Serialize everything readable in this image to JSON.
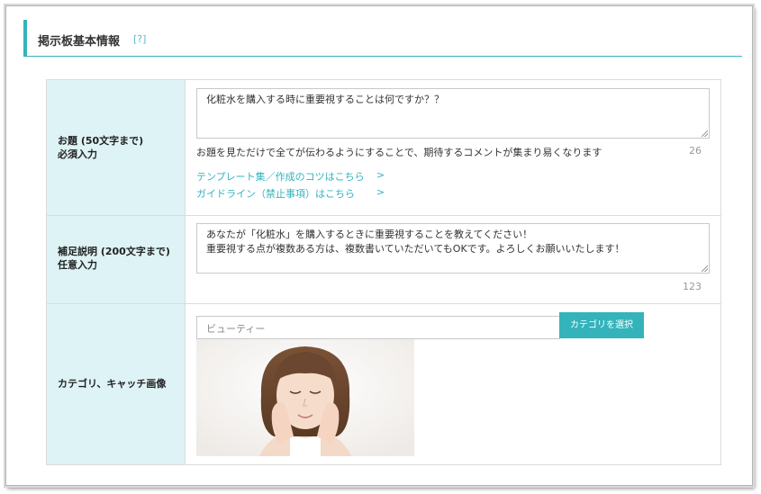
{
  "header": {
    "title": "掲示板基本情報",
    "help": "[?]"
  },
  "rows": {
    "topic": {
      "label_line1": "お題 (50文字まで)",
      "label_line2": "必須入力",
      "value": "化粧水を購入する時に重要視することは何ですか？？",
      "hint": "お題を見ただけで全てが伝わるようにすることで、期待するコメントが集まり易くなります",
      "count": "26",
      "links": [
        {
          "label": "テンプレート集／作成のコツはこちら",
          "arrow": ">"
        },
        {
          "label": "ガイドライン（禁止事項）はこちら",
          "arrow": ">"
        }
      ]
    },
    "description": {
      "label_line1": "補足説明 (200文字まで)",
      "label_line2": "任意入力",
      "value_line1": "あなたが「化粧水」を購入するときに重要視することを教えてください！",
      "value_line2": "重要視する点が複数ある方は、複数書いていただいてもOKです。よろしくお願いいたします！",
      "count": "123"
    },
    "category": {
      "label": "カテゴリ、キャッチ画像",
      "input_value": "ビューティー",
      "button_label": "カテゴリを選択"
    }
  },
  "colors": {
    "accent": "#34b3bb",
    "label_bg": "#def3f6",
    "help_link": "#5fb6d3"
  }
}
